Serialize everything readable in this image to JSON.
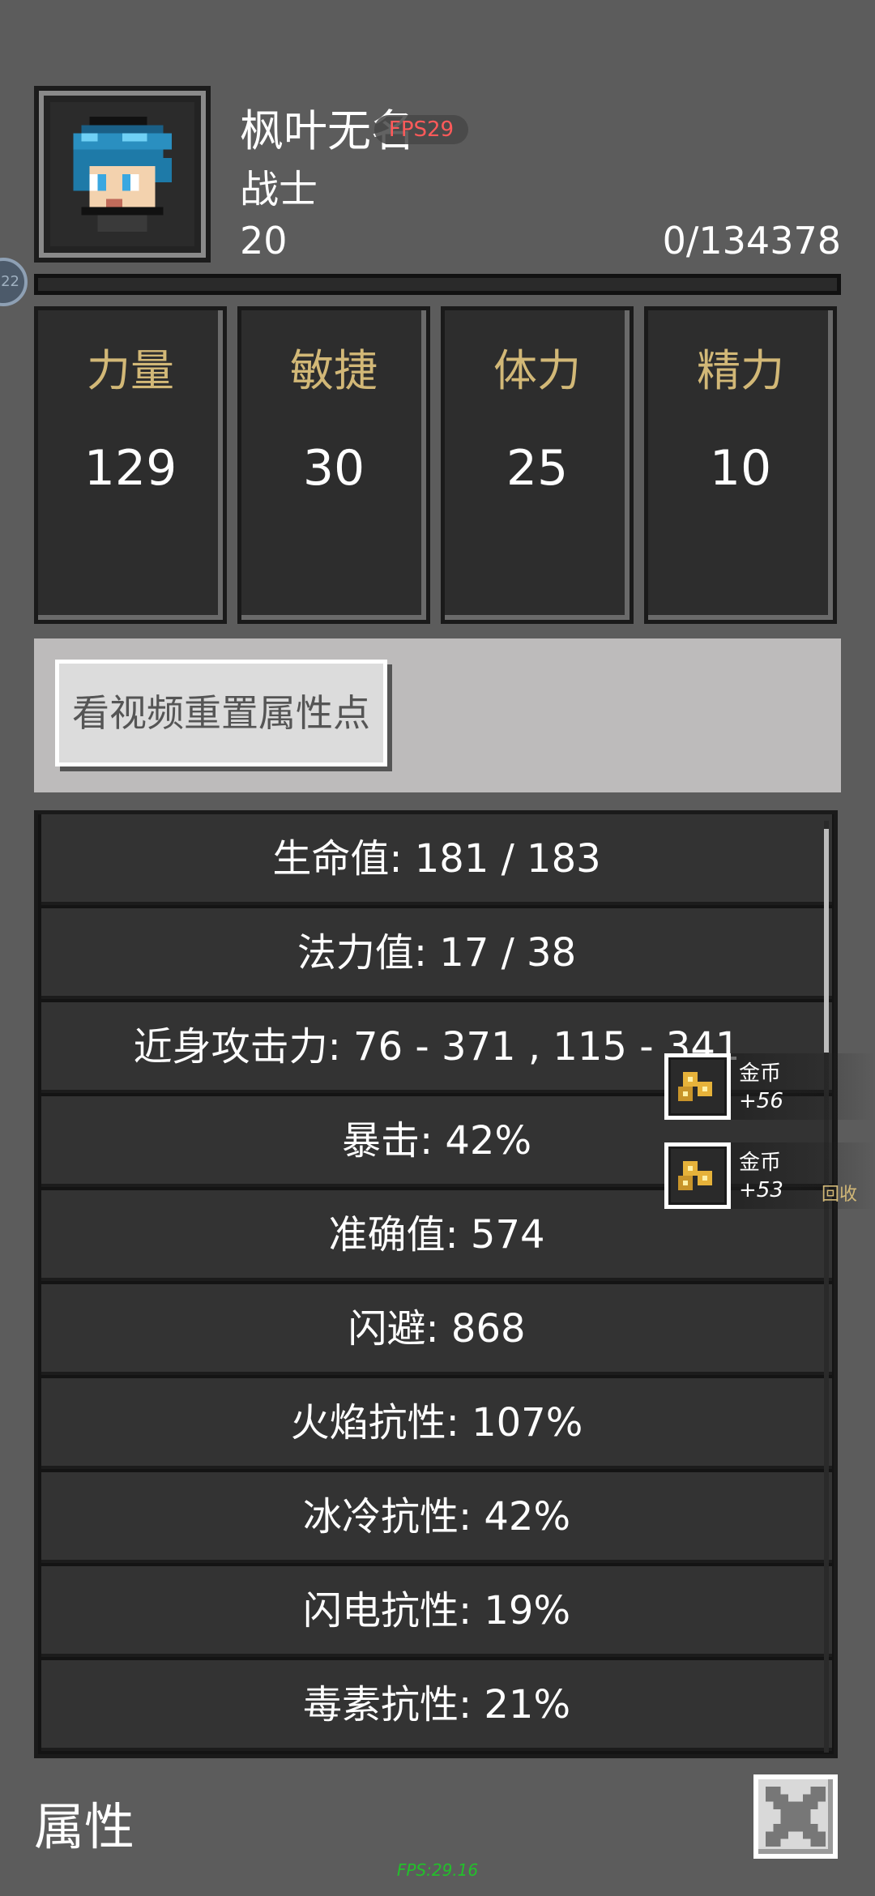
{
  "character": {
    "name": "枫叶无名",
    "class": "战士",
    "level": "20",
    "exp_text": "0/134378",
    "exp_fraction": 0.0
  },
  "overlay": {
    "fps_pill": "FPS29",
    "side_badge": "22",
    "fps_bottom": "FPS:29.16"
  },
  "stats": [
    {
      "label": "力量",
      "value": "129"
    },
    {
      "label": "敏捷",
      "value": "30"
    },
    {
      "label": "体力",
      "value": "25"
    },
    {
      "label": "精力",
      "value": "10"
    }
  ],
  "reset_button": "看视频重置属性点",
  "attributes": [
    "生命值: 181 / 183",
    "法力值: 17 / 38",
    "近身攻击力: 76 - 371 , 115 - 341",
    "暴击: 42%",
    "准确值: 574",
    "闪避: 868",
    "火焰抗性: 107%",
    "冰冷抗性: 42%",
    "闪电抗性: 19%",
    "毒素抗性: 21%"
  ],
  "toasts": [
    {
      "title": "金币",
      "amount": "+56",
      "icon": "gold-coins-icon"
    },
    {
      "title": "金币",
      "amount": "+53",
      "icon": "gold-coins-icon"
    }
  ],
  "recycle_label": "回收",
  "footer": {
    "title": "属性",
    "close_icon": "close-icon"
  },
  "colors": {
    "background": "#5c5c5c",
    "stat_label": "#d2b877",
    "card": "#2d2d2d",
    "fps_pill_text": "#ff5a5a",
    "fps_bottom_text": "#22c12a"
  }
}
